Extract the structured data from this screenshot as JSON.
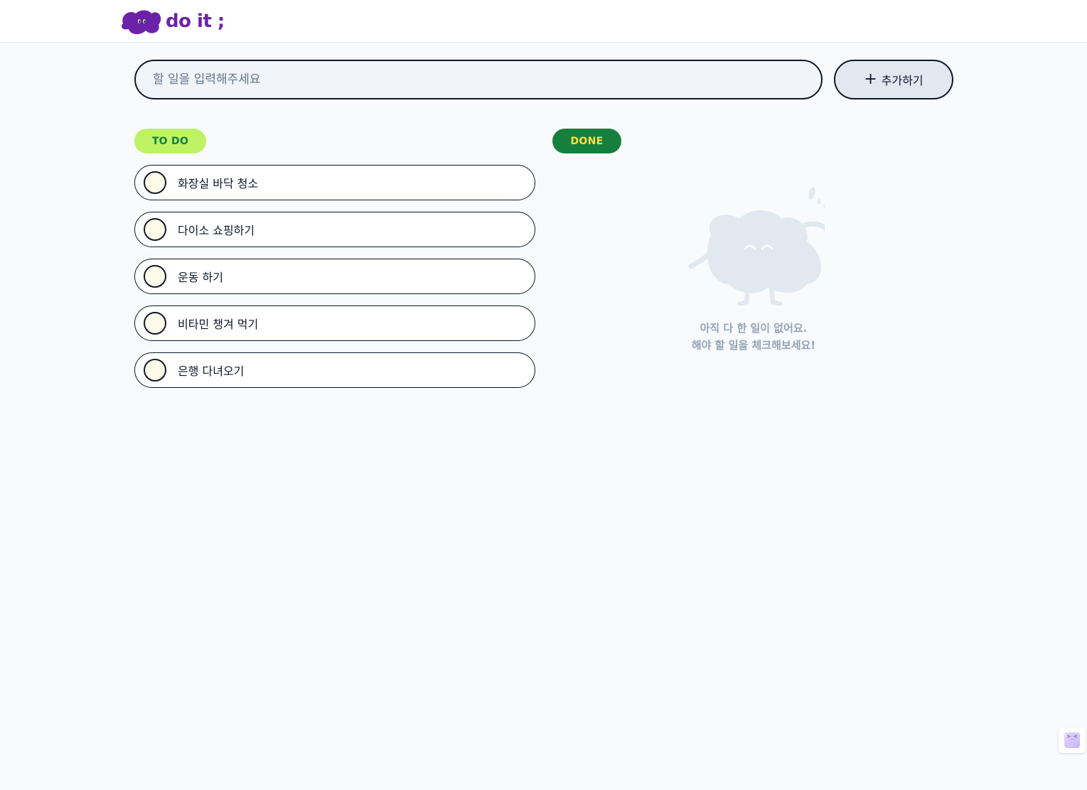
{
  "header": {
    "logo_text": "do it ;"
  },
  "add_bar": {
    "placeholder": "할 일을 입력해주세요",
    "value": "",
    "add_label": "추가하기",
    "add_icon": "+"
  },
  "sections": {
    "todo_label": "TO DO",
    "done_label": "DONE"
  },
  "todo_items": [
    {
      "text": "화장실 바닥 청소"
    },
    {
      "text": "다이소 쇼핑하기"
    },
    {
      "text": "운동 하기"
    },
    {
      "text": "비타민 챙겨 먹기"
    },
    {
      "text": "은행 다녀오기"
    }
  ],
  "done_empty": {
    "line1": "아직 다 한 일이 없어요.",
    "line2": "해야 할 일을 체크해보세요!"
  },
  "widget": {
    "face": ">_<"
  },
  "colors": {
    "brand": "#6b21a8",
    "todo_badge_bg": "#bef264",
    "todo_badge_text": "#15803d",
    "done_badge_bg": "#15803d",
    "done_badge_text": "#fde047",
    "page_bg": "#f8fafc"
  }
}
